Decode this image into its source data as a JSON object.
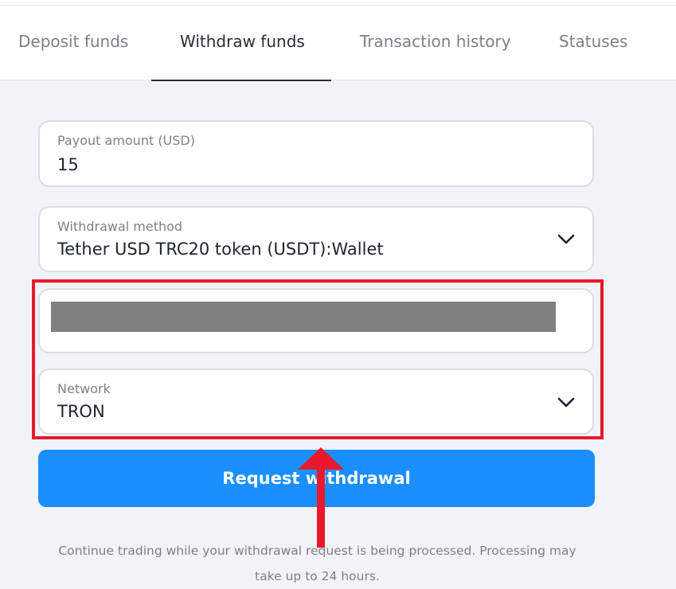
{
  "tabs": [
    {
      "label": "Deposit funds",
      "active": false
    },
    {
      "label": "Withdraw funds",
      "active": true
    },
    {
      "label": "Transaction history",
      "active": false
    },
    {
      "label": "Statuses",
      "active": false
    }
  ],
  "form": {
    "payout_amount": {
      "label": "Payout amount (USD)",
      "value": "15"
    },
    "withdrawal_method": {
      "label": "Withdrawal method",
      "value": "Tether USD TRC20 token (USDT):Wallet",
      "icon": "chevron-down-icon"
    },
    "wallet_address": {
      "value_hidden": true
    },
    "network": {
      "label": "Network",
      "value": "TRON",
      "icon": "chevron-down-icon"
    }
  },
  "submit_label": "Request withdrawal",
  "note_line1": "Continue trading while your withdrawal request is being processed.  Processing may",
  "note_line2": "take up to 24 hours.",
  "colors": {
    "accent": "#1a8fff",
    "highlight": "#e8192c",
    "background": "#f2f3f6",
    "redaction": "#808080"
  }
}
